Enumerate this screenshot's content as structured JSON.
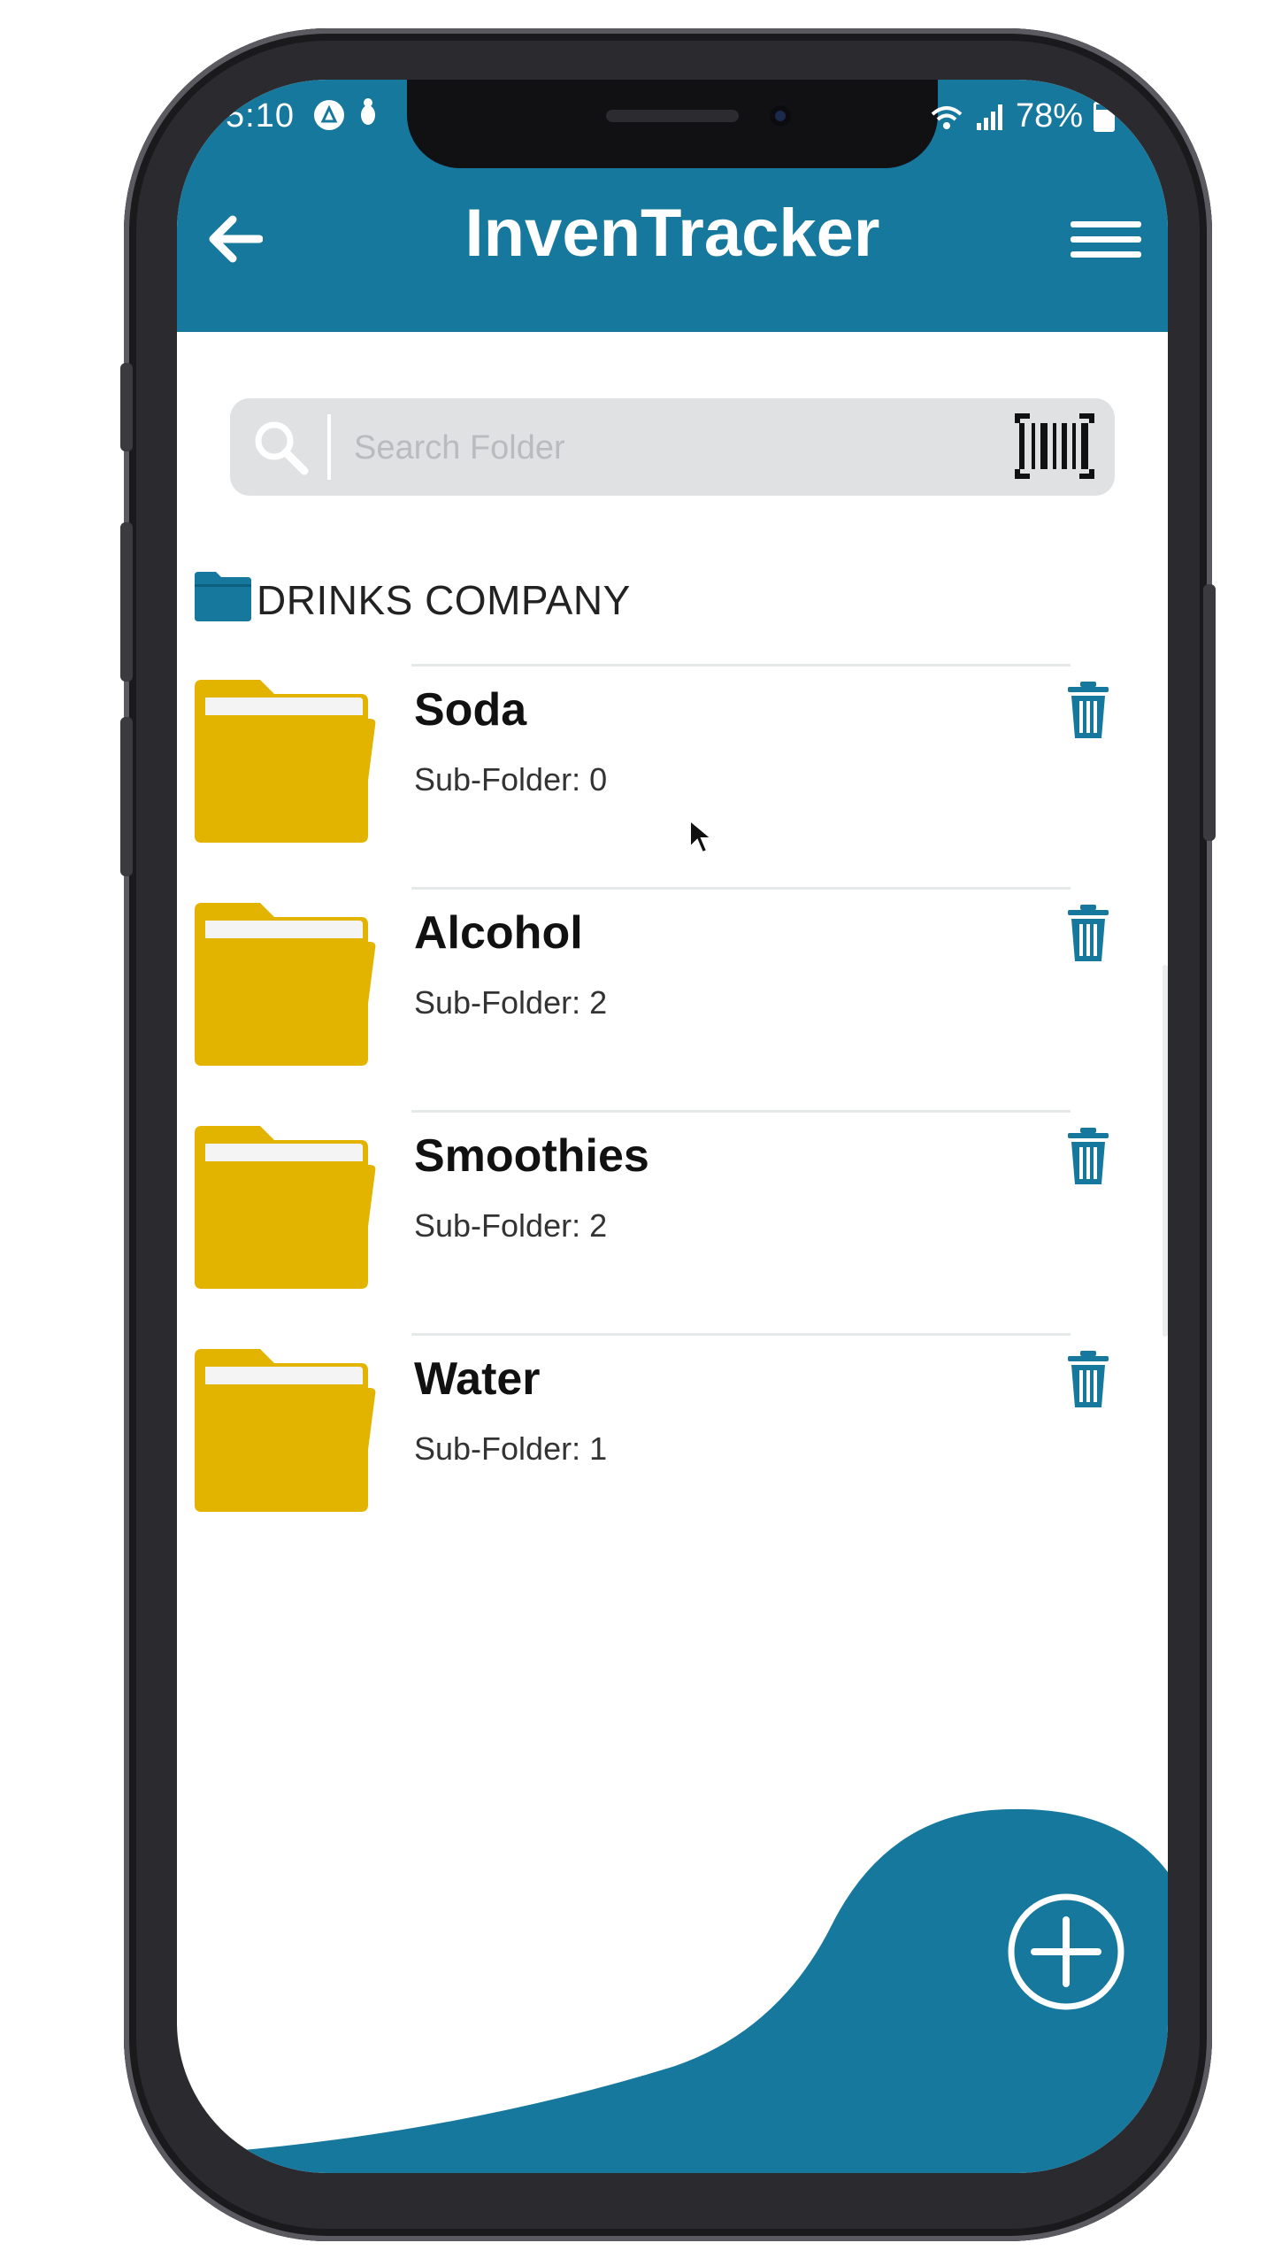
{
  "status_bar": {
    "time": "5:10",
    "battery": "78%"
  },
  "header": {
    "title": "InvenTracker",
    "back_icon": "arrow-left-icon",
    "menu_icon": "hamburger-menu-icon"
  },
  "search": {
    "placeholder": "Search Folder",
    "value": "",
    "search_icon": "search-icon",
    "scan_icon": "barcode-icon"
  },
  "breadcrumb": {
    "label": "DRINKS COMPANY",
    "icon": "folder-icon"
  },
  "folders": [
    {
      "name": "Soda",
      "sub_label": "Sub-Folder: 0"
    },
    {
      "name": "Alcohol",
      "sub_label": "Sub-Folder: 2"
    },
    {
      "name": "Smoothies",
      "sub_label": "Sub-Folder: 2"
    },
    {
      "name": "Water",
      "sub_label": "Sub-Folder: 1"
    }
  ],
  "fab": {
    "icon": "plus-circle-icon"
  },
  "colors": {
    "primary": "#16789d",
    "folder": "#e2b400",
    "folder_back": "#f2f2f2",
    "search_bg": "#dfe1e3"
  }
}
